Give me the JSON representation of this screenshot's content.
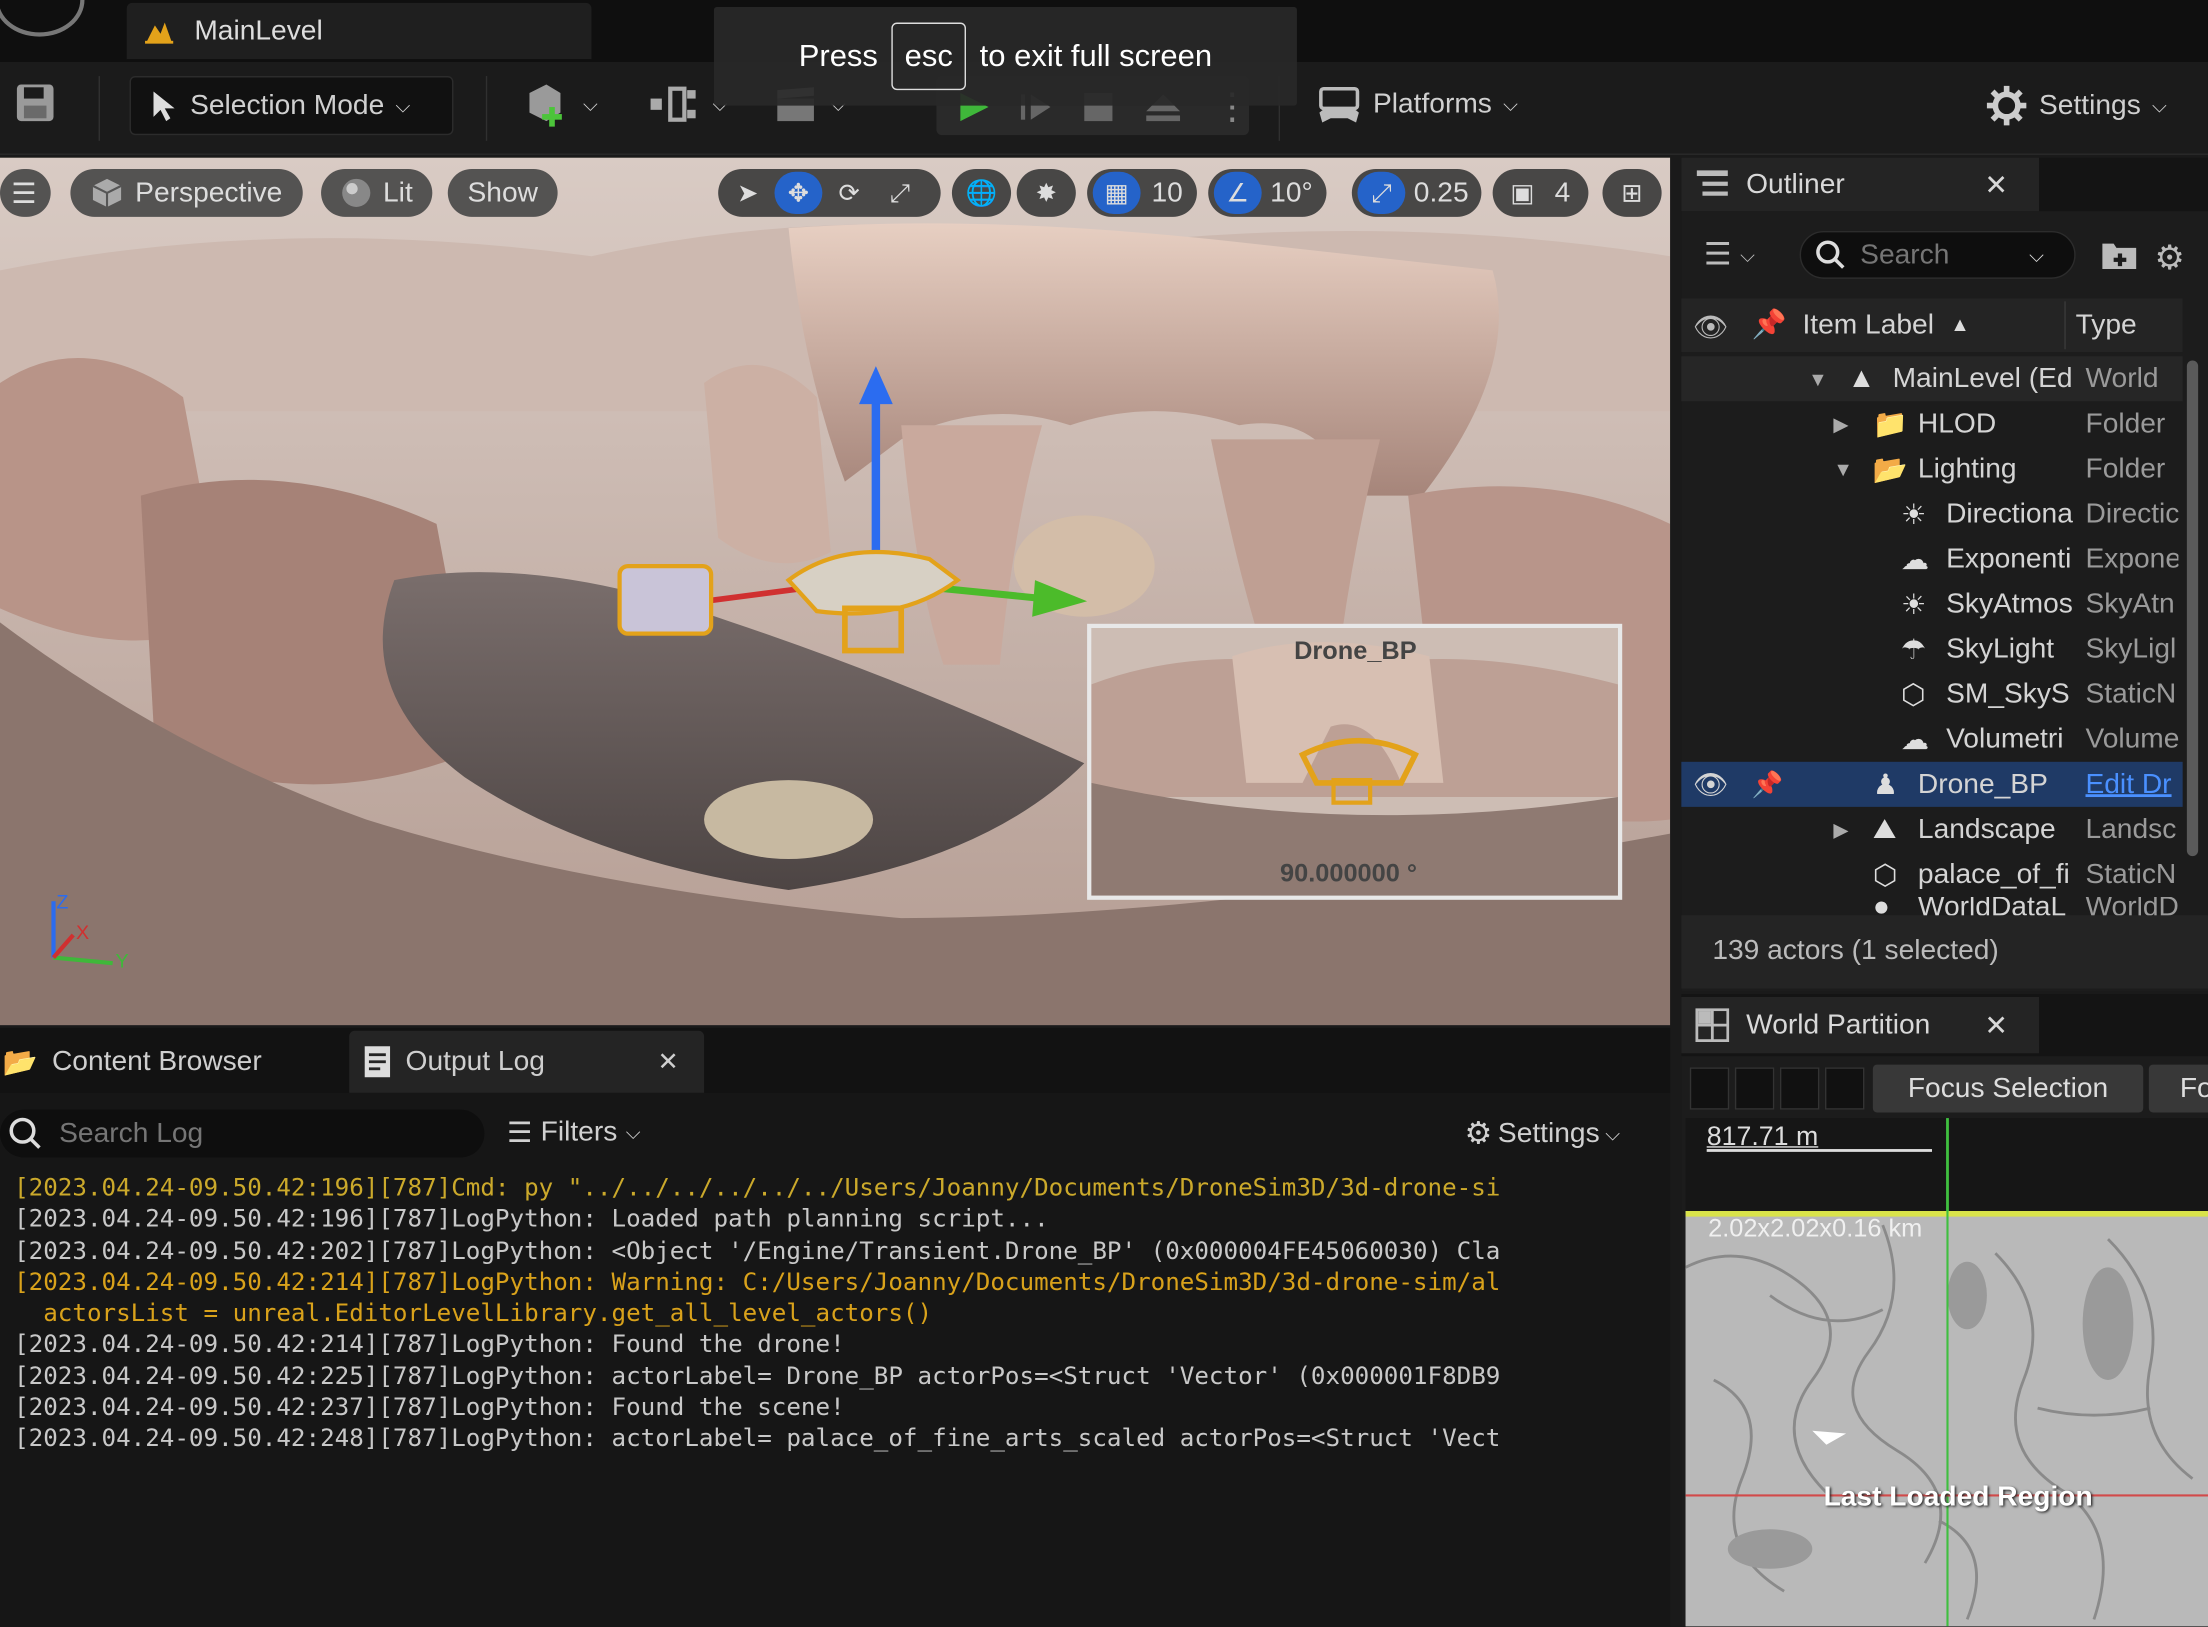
{
  "level_tab": {
    "title": "MainLevel"
  },
  "fullscreen_notice": {
    "pre": "Press",
    "key": "esc",
    "post": "to exit full screen"
  },
  "toolbar": {
    "selection_mode": "Selection Mode",
    "platforms": "Platforms",
    "settings": "Settings"
  },
  "viewport": {
    "perspective": "Perspective",
    "lit": "Lit",
    "show": "Show",
    "grid_snap": "10",
    "rotation_snap": "10°",
    "scale_snap": "0.25",
    "camera_speed": "4",
    "pip_title": "Drone_BP",
    "pip_angle": "90.000000 °",
    "axis_labels": {
      "z": "Z",
      "x": "X",
      "y": "Y"
    }
  },
  "outliner": {
    "title": "Outliner",
    "search_placeholder": "Search",
    "col_label": "Item Label",
    "col_type": "Type",
    "rows": [
      {
        "label": "MainLevel (Ed",
        "type": "World",
        "icon": "level-icon"
      },
      {
        "label": "HLOD",
        "type": "Folder",
        "icon": "folder-icon"
      },
      {
        "label": "Lighting",
        "type": "Folder",
        "icon": "folder-open-icon"
      },
      {
        "label": "Directiona",
        "type": "Directic",
        "icon": "sun-icon"
      },
      {
        "label": "Exponenti",
        "type": "Expone",
        "icon": "fog-icon"
      },
      {
        "label": "SkyAtmos",
        "type": "SkyAtn",
        "icon": "sky-atmosphere-icon"
      },
      {
        "label": "SkyLight",
        "type": "SkyLigl",
        "icon": "skylight-icon"
      },
      {
        "label": "SM_SkyS",
        "type": "StaticN",
        "icon": "static-mesh-icon"
      },
      {
        "label": "Volumetri",
        "type": "Volume",
        "icon": "cloud-icon"
      },
      {
        "label": "Drone_BP",
        "type": "Edit Dr",
        "icon": "pawn-icon"
      },
      {
        "label": "Landscape",
        "type": "Landsc",
        "icon": "landscape-icon"
      },
      {
        "label": "palace_of_fi",
        "type": "StaticN",
        "icon": "static-mesh-icon"
      },
      {
        "label": "WorldDataL",
        "type": "WorldD",
        "icon": "world-icon"
      }
    ],
    "status": "139 actors (1 selected)"
  },
  "bottom": {
    "tab_content_browser": "Content Browser",
    "tab_output_log": "Output Log",
    "search_placeholder": "Search Log",
    "filters": "Filters",
    "settings": "Settings",
    "log_lines": [
      {
        "text": "[2023.04.24-09.50.42:196][787]Cmd: py \"../../../../../../Users/Joanny/Documents/DroneSim3D/3d-drone-si",
        "level": "cmd"
      },
      {
        "text": "[2023.04.24-09.50.42:196][787]LogPython: Loaded path planning script...",
        "level": "info"
      },
      {
        "text": "[2023.04.24-09.50.42:202][787]LogPython: <Object '/Engine/Transient.Drone_BP' (0x000004FE45060030) Cla",
        "level": "info"
      },
      {
        "text": "[2023.04.24-09.50.42:214][787]LogPython: Warning: C:/Users/Joanny/Documents/DroneSim3D/3d-drone-sim/al",
        "level": "warn"
      },
      {
        "text": "  actorsList = unreal.EditorLevelLibrary.get_all_level_actors()",
        "level": "warn"
      },
      {
        "text": "[2023.04.24-09.50.42:214][787]LogPython: Found the drone!",
        "level": "info"
      },
      {
        "text": "[2023.04.24-09.50.42:225][787]LogPython: actorLabel= Drone_BP actorPos=<Struct 'Vector' (0x000001F8DB9",
        "level": "info"
      },
      {
        "text": "[2023.04.24-09.50.42:237][787]LogPython: Found the scene!",
        "level": "info"
      },
      {
        "text": "[2023.04.24-09.50.42:248][787]LogPython: actorLabel= palace_of_fine_arts_scaled actorPos=<Struct 'Vect",
        "level": "info"
      }
    ],
    "colors": {
      "cmd": "#cba92b",
      "info": "#c8c8c8",
      "warn": "#d9a21b"
    }
  },
  "world_partition": {
    "title": "World Partition",
    "focus_selection": "Focus Selection",
    "focus_other": "Fo",
    "scale": "817.71 m",
    "size": "2.02x2.02x0.16 km",
    "region_label": "Last Loaded Region"
  }
}
